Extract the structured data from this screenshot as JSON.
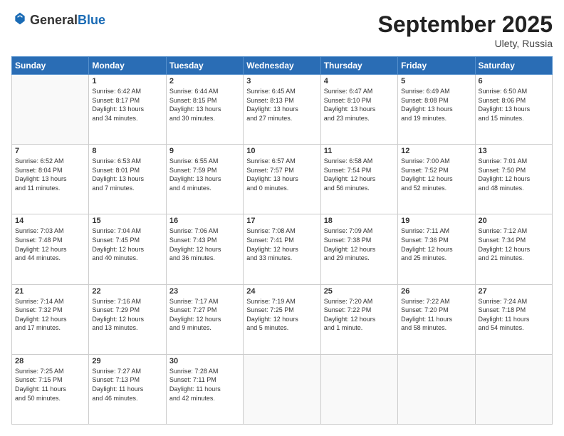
{
  "header": {
    "logo_line1": "General",
    "logo_line2": "Blue",
    "month": "September 2025",
    "location": "Ulety, Russia"
  },
  "weekdays": [
    "Sunday",
    "Monday",
    "Tuesday",
    "Wednesday",
    "Thursday",
    "Friday",
    "Saturday"
  ],
  "weeks": [
    [
      {
        "day": "",
        "info": ""
      },
      {
        "day": "1",
        "info": "Sunrise: 6:42 AM\nSunset: 8:17 PM\nDaylight: 13 hours\nand 34 minutes."
      },
      {
        "day": "2",
        "info": "Sunrise: 6:44 AM\nSunset: 8:15 PM\nDaylight: 13 hours\nand 30 minutes."
      },
      {
        "day": "3",
        "info": "Sunrise: 6:45 AM\nSunset: 8:13 PM\nDaylight: 13 hours\nand 27 minutes."
      },
      {
        "day": "4",
        "info": "Sunrise: 6:47 AM\nSunset: 8:10 PM\nDaylight: 13 hours\nand 23 minutes."
      },
      {
        "day": "5",
        "info": "Sunrise: 6:49 AM\nSunset: 8:08 PM\nDaylight: 13 hours\nand 19 minutes."
      },
      {
        "day": "6",
        "info": "Sunrise: 6:50 AM\nSunset: 8:06 PM\nDaylight: 13 hours\nand 15 minutes."
      }
    ],
    [
      {
        "day": "7",
        "info": "Sunrise: 6:52 AM\nSunset: 8:04 PM\nDaylight: 13 hours\nand 11 minutes."
      },
      {
        "day": "8",
        "info": "Sunrise: 6:53 AM\nSunset: 8:01 PM\nDaylight: 13 hours\nand 7 minutes."
      },
      {
        "day": "9",
        "info": "Sunrise: 6:55 AM\nSunset: 7:59 PM\nDaylight: 13 hours\nand 4 minutes."
      },
      {
        "day": "10",
        "info": "Sunrise: 6:57 AM\nSunset: 7:57 PM\nDaylight: 13 hours\nand 0 minutes."
      },
      {
        "day": "11",
        "info": "Sunrise: 6:58 AM\nSunset: 7:54 PM\nDaylight: 12 hours\nand 56 minutes."
      },
      {
        "day": "12",
        "info": "Sunrise: 7:00 AM\nSunset: 7:52 PM\nDaylight: 12 hours\nand 52 minutes."
      },
      {
        "day": "13",
        "info": "Sunrise: 7:01 AM\nSunset: 7:50 PM\nDaylight: 12 hours\nand 48 minutes."
      }
    ],
    [
      {
        "day": "14",
        "info": "Sunrise: 7:03 AM\nSunset: 7:48 PM\nDaylight: 12 hours\nand 44 minutes."
      },
      {
        "day": "15",
        "info": "Sunrise: 7:04 AM\nSunset: 7:45 PM\nDaylight: 12 hours\nand 40 minutes."
      },
      {
        "day": "16",
        "info": "Sunrise: 7:06 AM\nSunset: 7:43 PM\nDaylight: 12 hours\nand 36 minutes."
      },
      {
        "day": "17",
        "info": "Sunrise: 7:08 AM\nSunset: 7:41 PM\nDaylight: 12 hours\nand 33 minutes."
      },
      {
        "day": "18",
        "info": "Sunrise: 7:09 AM\nSunset: 7:38 PM\nDaylight: 12 hours\nand 29 minutes."
      },
      {
        "day": "19",
        "info": "Sunrise: 7:11 AM\nSunset: 7:36 PM\nDaylight: 12 hours\nand 25 minutes."
      },
      {
        "day": "20",
        "info": "Sunrise: 7:12 AM\nSunset: 7:34 PM\nDaylight: 12 hours\nand 21 minutes."
      }
    ],
    [
      {
        "day": "21",
        "info": "Sunrise: 7:14 AM\nSunset: 7:32 PM\nDaylight: 12 hours\nand 17 minutes."
      },
      {
        "day": "22",
        "info": "Sunrise: 7:16 AM\nSunset: 7:29 PM\nDaylight: 12 hours\nand 13 minutes."
      },
      {
        "day": "23",
        "info": "Sunrise: 7:17 AM\nSunset: 7:27 PM\nDaylight: 12 hours\nand 9 minutes."
      },
      {
        "day": "24",
        "info": "Sunrise: 7:19 AM\nSunset: 7:25 PM\nDaylight: 12 hours\nand 5 minutes."
      },
      {
        "day": "25",
        "info": "Sunrise: 7:20 AM\nSunset: 7:22 PM\nDaylight: 12 hours\nand 1 minute."
      },
      {
        "day": "26",
        "info": "Sunrise: 7:22 AM\nSunset: 7:20 PM\nDaylight: 11 hours\nand 58 minutes."
      },
      {
        "day": "27",
        "info": "Sunrise: 7:24 AM\nSunset: 7:18 PM\nDaylight: 11 hours\nand 54 minutes."
      }
    ],
    [
      {
        "day": "28",
        "info": "Sunrise: 7:25 AM\nSunset: 7:15 PM\nDaylight: 11 hours\nand 50 minutes."
      },
      {
        "day": "29",
        "info": "Sunrise: 7:27 AM\nSunset: 7:13 PM\nDaylight: 11 hours\nand 46 minutes."
      },
      {
        "day": "30",
        "info": "Sunrise: 7:28 AM\nSunset: 7:11 PM\nDaylight: 11 hours\nand 42 minutes."
      },
      {
        "day": "",
        "info": ""
      },
      {
        "day": "",
        "info": ""
      },
      {
        "day": "",
        "info": ""
      },
      {
        "day": "",
        "info": ""
      }
    ]
  ]
}
